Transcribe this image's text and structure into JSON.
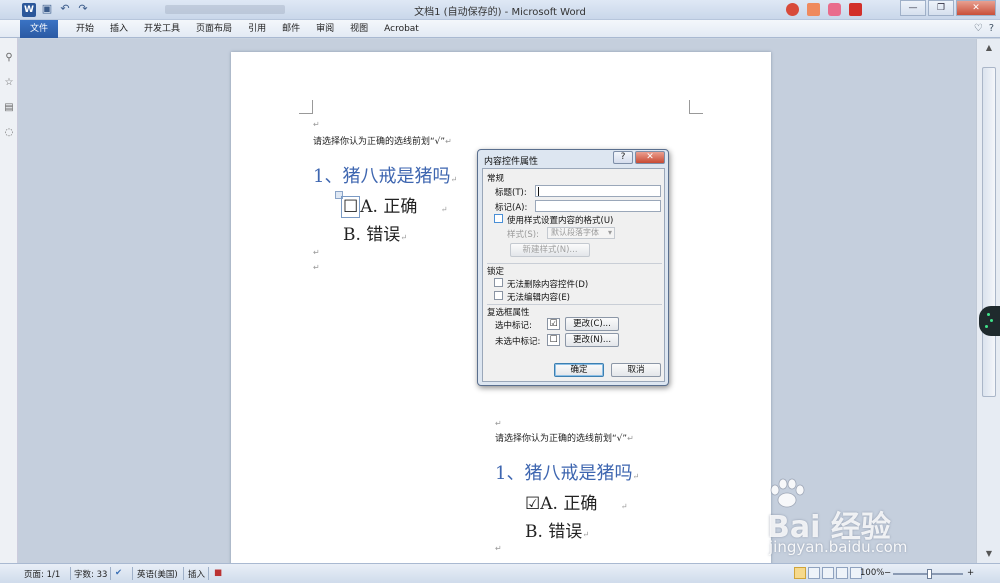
{
  "window": {
    "title": "文档1 (自动保存的) - Microsoft Word",
    "app_icon_letter": "W",
    "buttons": [
      "—",
      "❐",
      "✕"
    ]
  },
  "ribbon": {
    "file_tab": "文件",
    "tabs": [
      "开始",
      "插入",
      "开发工具",
      "页面布局",
      "引用",
      "邮件",
      "审阅",
      "视图",
      "Acrobat"
    ],
    "right_icons": [
      "♡",
      "?",
      "⌃"
    ]
  },
  "document": {
    "section1": {
      "instruction": "请选择你认为正确的选线前划“√”",
      "question": "1、猪八戒是猪吗",
      "option_a": "A. 正确",
      "option_b": "B. 错误",
      "unchecked_symbol": "☐"
    },
    "section2": {
      "instruction": "请选择你认为正确的选线前划“√”",
      "question": "1、猪八戒是猪吗",
      "option_a": "A. 正确",
      "option_b": "B. 错误",
      "checked_symbol": "☑"
    },
    "paragraph_mark": "↵"
  },
  "dialog": {
    "title": "内容控件属性",
    "help": "?",
    "close": "✕",
    "general_group": "常规",
    "title_label": "标题(T):",
    "title_value": "",
    "tag_label": "标记(A):",
    "tag_value": "",
    "use_style_label": "使用样式设置内容的格式(U)",
    "style_label": "样式(S):",
    "style_value": "默认段落字体",
    "new_style_button": "新建样式(N)...",
    "locking_group": "锁定",
    "cannot_delete_label": "无法删除内容控件(D)",
    "cannot_edit_label": "无法编辑内容(E)",
    "checkbox_props_group": "复选框属性",
    "checked_symbol_label": "选中标记:",
    "checked_symbol": "☑",
    "change_checked_button": "更改(C)...",
    "unchecked_symbol_label": "未选中标记:",
    "unchecked_symbol": "☐",
    "change_unchecked_button": "更改(N)...",
    "ok_button": "确定",
    "cancel_button": "取消"
  },
  "statusbar": {
    "page": "页面: 1/1",
    "words": "字数: 33",
    "language": "英语(美国)",
    "insert_mode": "插入",
    "zoom": "100%",
    "zoom_minus": "−",
    "zoom_plus": "+"
  },
  "watermark": {
    "brand": "Bai 经验",
    "url": "jingyan.baidu.com"
  }
}
